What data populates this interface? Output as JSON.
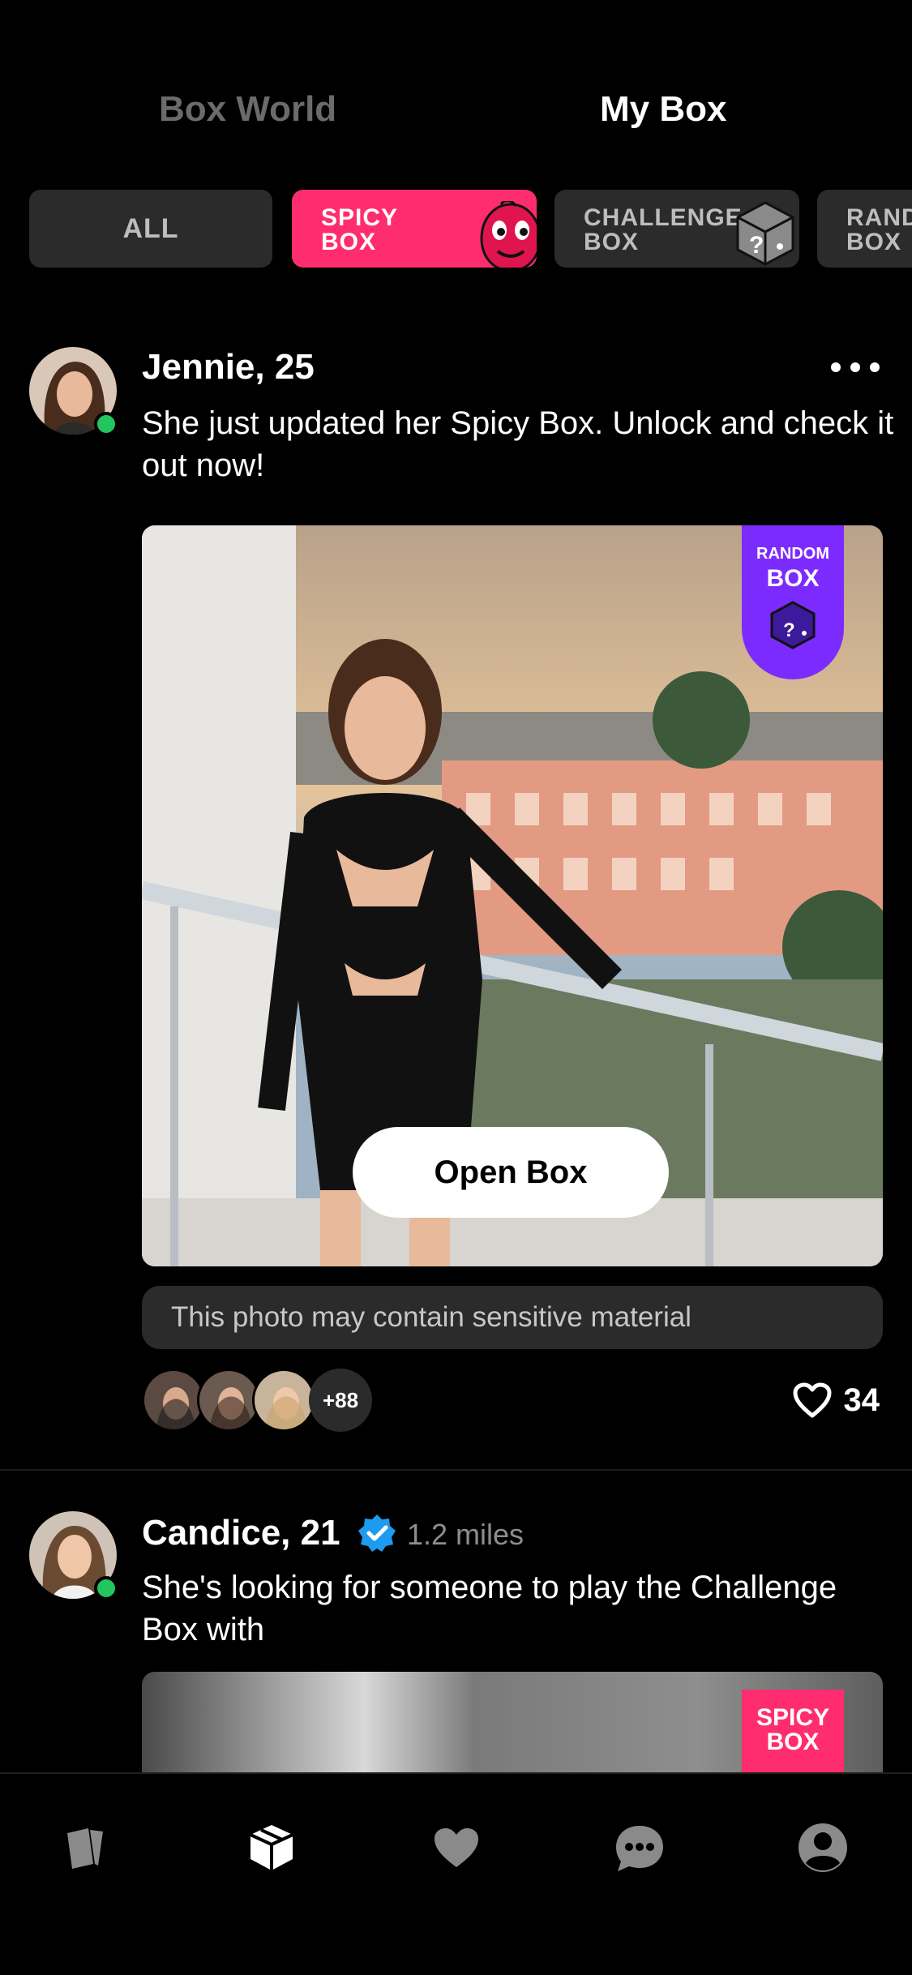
{
  "top_tabs": [
    {
      "label": "Box World",
      "active": false
    },
    {
      "label": "My Box",
      "active": true
    }
  ],
  "filters": [
    {
      "label": "ALL",
      "icon": "none"
    },
    {
      "label_line1": "SPICY",
      "label_line2": "BOX",
      "icon": "spicy-face-icon",
      "active": true
    },
    {
      "label_line1": "CHALLENGE",
      "label_line2": "BOX",
      "icon": "question-dice-icon"
    },
    {
      "label_line1": "RAND",
      "label_line2": "BOX",
      "icon": "none"
    }
  ],
  "posts": [
    {
      "name": "Jennie, 25",
      "text": "She just updated her Spicy Box. Unlock and check it out now!",
      "online": true,
      "badge_line1": "RANDOM",
      "badge_line2": "BOX",
      "open_button": "Open Box",
      "sensitive_notice": "This photo may contain sensitive material",
      "viewer_more": "+88",
      "likes": "34"
    },
    {
      "name": "Candice, 21",
      "verified": true,
      "distance": "1.2 miles",
      "text": "She's looking for someone to play the Challenge Box with",
      "online": true,
      "badge_line1": "SPICY",
      "badge_line2": "BOX"
    }
  ],
  "bottom_nav": [
    {
      "icon": "cards-icon",
      "active": false
    },
    {
      "icon": "box-icon",
      "active": true
    },
    {
      "icon": "heart-icon",
      "active": false
    },
    {
      "icon": "chat-icon",
      "active": false
    },
    {
      "icon": "profile-icon",
      "active": false
    }
  ],
  "colors": {
    "background": "#000000",
    "accent_spicy": "#ff2d6f",
    "accent_random": "#7c2bff",
    "online": "#22c55e",
    "verified": "#1d9bf0",
    "chip_bg": "#2b2b2b"
  }
}
